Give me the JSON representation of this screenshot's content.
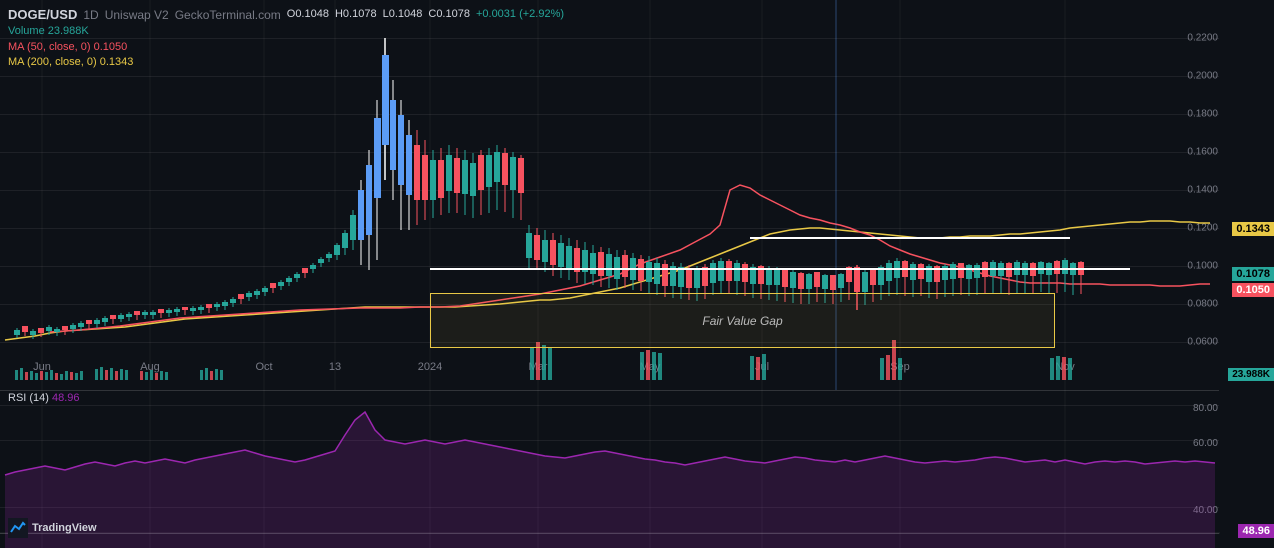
{
  "header": {
    "symbol": "DOGE/USD",
    "timeframe": "1D",
    "exchange": "Uniswap V2",
    "source": "GeckoTerminal.com",
    "open": "0.1048",
    "high": "0.1078",
    "low": "0.1048",
    "close": "0.1078",
    "change": "+0.0031 (+2.92%)",
    "volume_label": "Volume",
    "volume_value": "23.988K",
    "ma50_label": "MA (50, close, 0)",
    "ma50_value": "0.1050",
    "ma200_label": "MA (200, close, 0)",
    "ma200_value": "0.1343"
  },
  "rsi": {
    "label": "RSI (14)",
    "value": "48.96"
  },
  "price_labels": {
    "ma200": "0.1343",
    "close": "0.1078",
    "ma50": "0.1050",
    "volume": "23.988K",
    "rsi_val": "48.96"
  },
  "fvg": {
    "text": "Fair Value Gap"
  },
  "grid_prices": [
    "0.2200",
    "0.2000",
    "0.1800",
    "0.1600",
    "0.1400",
    "0.1200",
    "0.1000",
    "0.0800"
  ],
  "rsi_grid": [
    "80.00",
    "60.00",
    "40.00"
  ],
  "x_labels": [
    "Jun",
    "Aug",
    "Oct",
    "13",
    "2024",
    "Mar",
    "May",
    "Jul",
    "Sep",
    "Nov"
  ],
  "x_positions": [
    42,
    150,
    264,
    335,
    430,
    538,
    650,
    762,
    900,
    1065
  ]
}
